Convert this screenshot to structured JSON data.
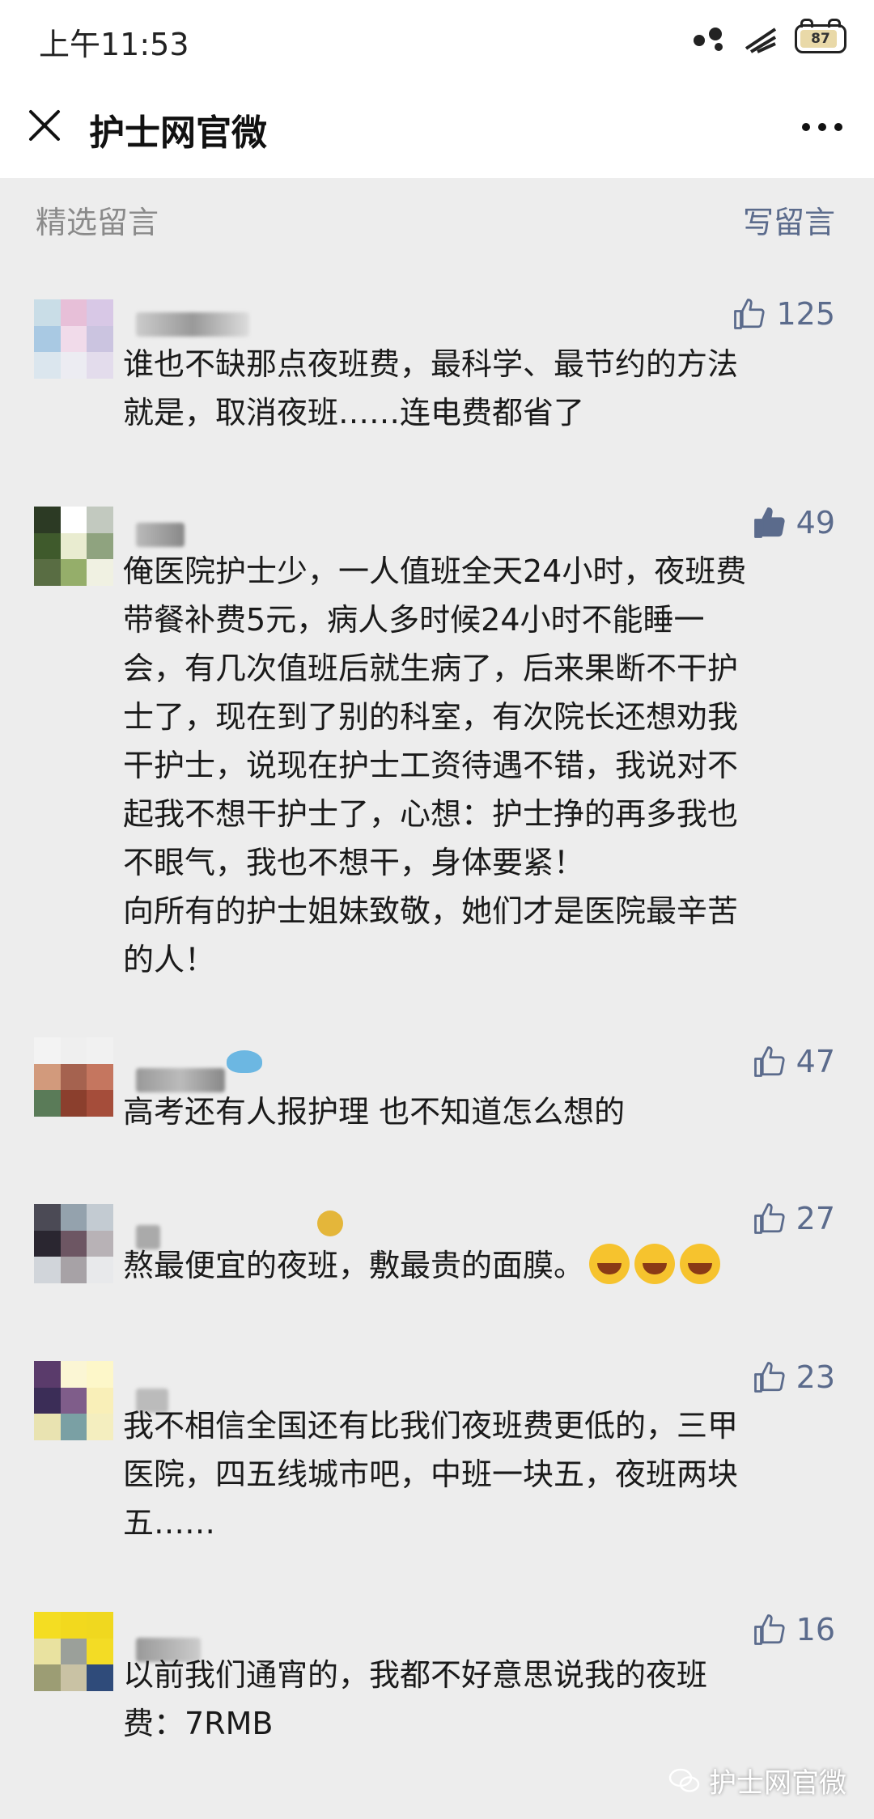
{
  "status_bar": {
    "time": "上午11:53",
    "battery": "87",
    "battery_level": 0.87
  },
  "nav": {
    "title": "护士网官微"
  },
  "section": {
    "title": "精选留言",
    "write_label": "写留言"
  },
  "comments": [
    {
      "likes": "125",
      "liked": false,
      "lines": [
        "谁也不缺那点夜班费，最科学、最节约的方法",
        "就是，取消夜班……连电费都省了"
      ]
    },
    {
      "likes": "49",
      "liked": true,
      "lines": [
        "俺医院护士少，一人值班全天24小时，夜班费",
        "带餐补费5元，病人多时候24小时不能睡一",
        "会，有几次值班后就生病了，后来果断不干护",
        "士了，现在到了别的科室，有次院长还想劝我",
        "干护士，说现在护士工资待遇不错，我说对不",
        "起我不想干护士了，心想：护士挣的再多我也",
        "不眼气，我也不想干，身体要紧！",
        "向所有的护士姐妹致敬，她们才是医院最辛苦",
        "的人！"
      ]
    },
    {
      "likes": "47",
      "liked": false,
      "lines": [
        "高考还有人报护理 也不知道怎么想的"
      ]
    },
    {
      "likes": "27",
      "liked": false,
      "lines": [
        "熬最便宜的夜班，敷最贵的面膜。"
      ]
    },
    {
      "likes": "23",
      "liked": false,
      "lines": [
        "我不相信全国还有比我们夜班费更低的，三甲",
        "医院，四五线城市吧，中班一块五，夜班两块",
        "五……"
      ]
    },
    {
      "likes": "16",
      "liked": false,
      "lines": [
        "以前我们通宵的，我都不好意思说我的夜班",
        "费：7RMB"
      ]
    }
  ],
  "watermark": {
    "text": "护士网官微"
  },
  "colors": {
    "link": "#5b6b8c",
    "background": "#ededed",
    "muted": "#8a8a8a"
  },
  "icons": {
    "close": "close-icon",
    "more": "more-icon",
    "like": "thumbs-up-icon",
    "wechat": "wechat-icon"
  }
}
